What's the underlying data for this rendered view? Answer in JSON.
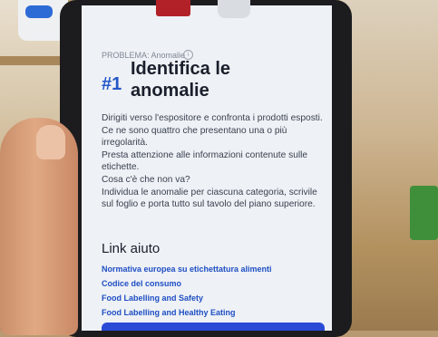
{
  "screen": {
    "problem_label": "PROBLEMA: Anomalie",
    "number": "#1",
    "heading": "Identifica le anomalie",
    "paragraphs": [
      "Dirigiti verso l'espositore e confronta i prodotti esposti. Ce ne sono quattro che presentano una o più irregolarità.",
      "Presta attenzione alle informazioni contenute sulle etichette.",
      "Cosa c'è che non va?",
      "Individua le anomalie per ciascuna categoria, scrivile sul foglio e porta tutto sul tavolo del piano superiore."
    ],
    "links_title": "Link aiuto",
    "links": [
      "Normativa europea su etichettatura alimenti",
      "Codice del consumo",
      "Food Labelling and Safety",
      "Food Labelling and Healthy Eating"
    ],
    "colors": {
      "accent": "#2457c9",
      "link": "#1f4fc4",
      "button": "#2a4bd6"
    }
  }
}
